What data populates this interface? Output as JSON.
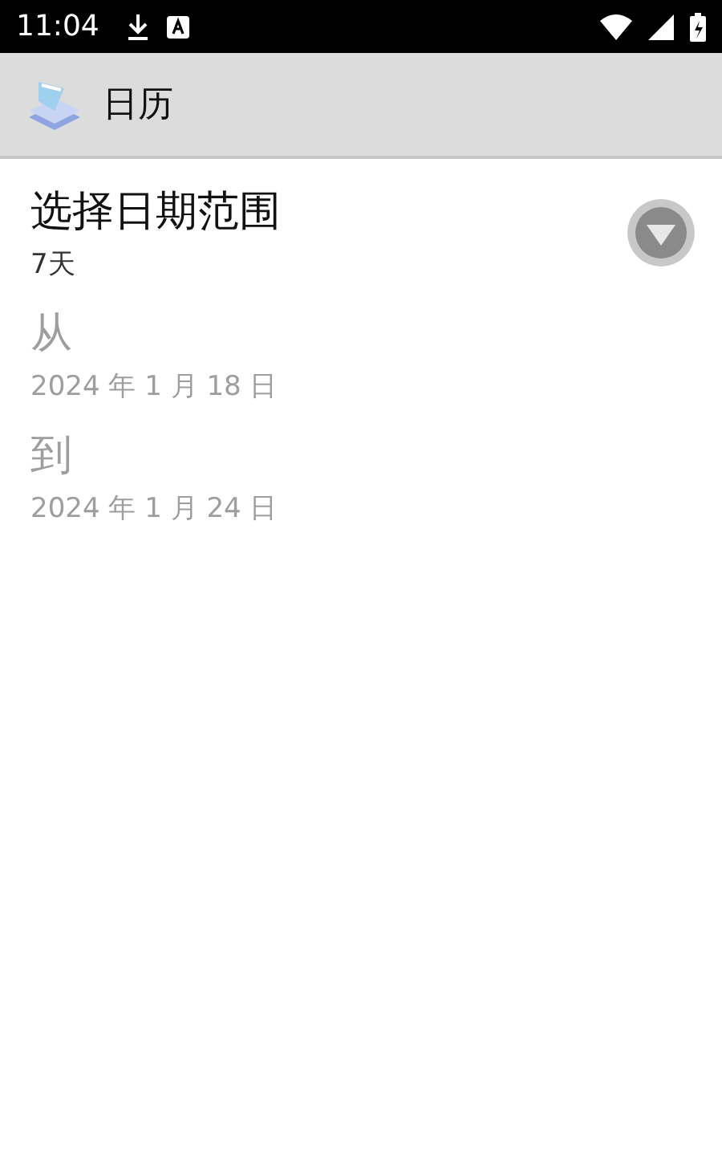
{
  "status_bar": {
    "time": "11:04"
  },
  "action_bar": {
    "title": "日历"
  },
  "settings": [
    {
      "kind": "dropdown",
      "title": "选择日期范围",
      "summary": "7天",
      "disabled": false
    },
    {
      "kind": "plain",
      "title": "从",
      "summary": "2024 年 1 月 18 日",
      "disabled": true
    },
    {
      "kind": "plain",
      "title": "到",
      "summary": "2024 年 1 月 24 日",
      "disabled": true
    }
  ]
}
